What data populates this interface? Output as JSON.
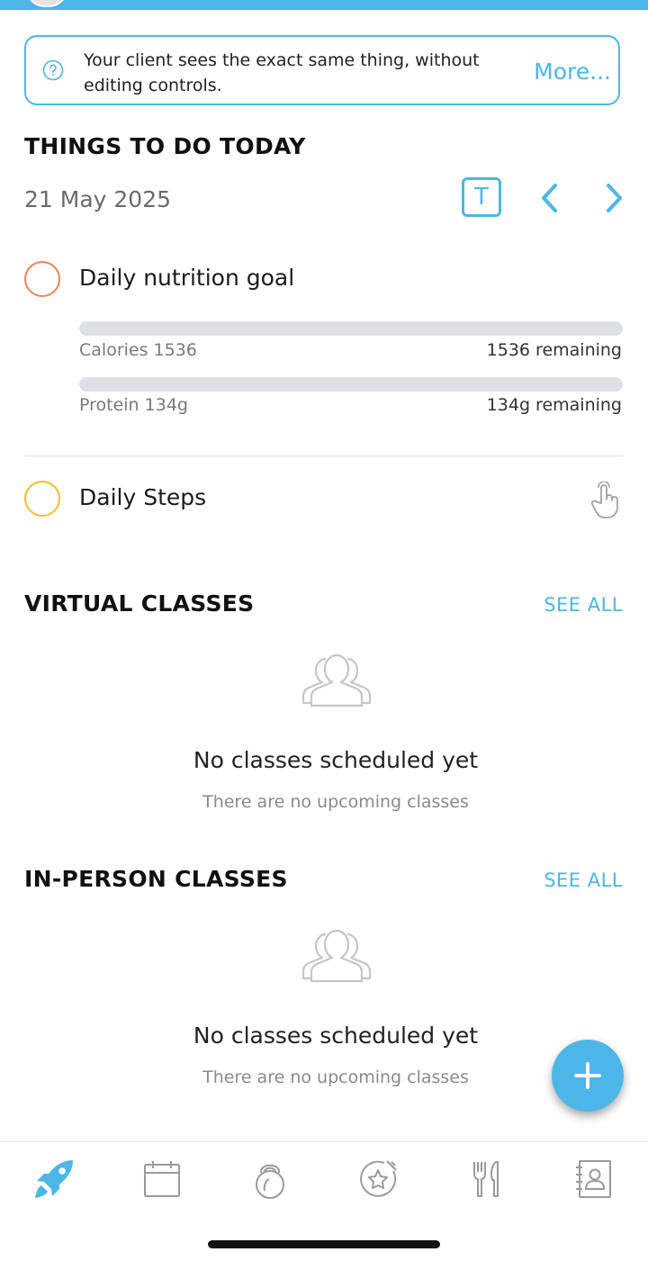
{
  "banner": {
    "text": "Your client sees the exact same thing, without editing controls.",
    "more_label": "More..."
  },
  "today": {
    "title": "THINGS TO DO TODAY",
    "date": "21 May 2025",
    "today_button_label": "T"
  },
  "tasks": {
    "nutrition": {
      "label": "Daily nutrition goal",
      "ring_color": "#f08354",
      "calories": {
        "label": "Calories 1536",
        "remaining": "1536 remaining",
        "progress": 0
      },
      "protein": {
        "label": "Protein 134g",
        "remaining": "134g remaining",
        "progress": 0
      }
    },
    "steps": {
      "label": "Daily Steps",
      "ring_color": "#f5bd2a"
    }
  },
  "virtual_classes": {
    "title": "VIRTUAL CLASSES",
    "see_all": "SEE ALL",
    "empty_title": "No classes scheduled yet",
    "empty_subtitle": "There are no upcoming classes"
  },
  "in_person_classes": {
    "title": "IN-PERSON CLASSES",
    "see_all": "SEE ALL",
    "empty_title": "No classes scheduled yet",
    "empty_subtitle": "There are no upcoming classes"
  },
  "colors": {
    "accent": "#4cb6e8",
    "inactive_icon": "#9a9a9a"
  },
  "bottom_nav": [
    {
      "icon": "rocket-icon",
      "active": true
    },
    {
      "icon": "calendar-icon",
      "active": false
    },
    {
      "icon": "kettlebell-icon",
      "active": false
    },
    {
      "icon": "achievement-star-icon",
      "active": false
    },
    {
      "icon": "fork-knife-icon",
      "active": false
    },
    {
      "icon": "contact-book-icon",
      "active": false
    }
  ]
}
